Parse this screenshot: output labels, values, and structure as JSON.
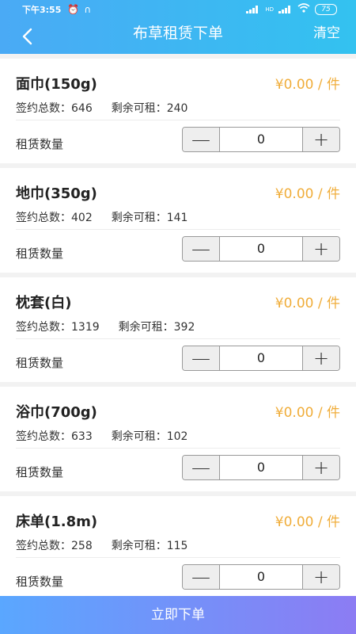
{
  "status_bar": {
    "time": "下午3:55",
    "battery": "75",
    "network": "HD"
  },
  "header": {
    "title": "布草租赁下单",
    "clear_label": "清空"
  },
  "labels": {
    "signed_total": "签约总数：",
    "remaining": "剩余可租：",
    "quantity": "租赁数量"
  },
  "items": [
    {
      "name": "面巾(150g)",
      "price": "¥0.00 / 件",
      "signed_total": "646",
      "remaining": "240",
      "quantity": "0"
    },
    {
      "name": "地巾(350g)",
      "price": "¥0.00 / 件",
      "signed_total": "402",
      "remaining": "141",
      "quantity": "0"
    },
    {
      "name": "枕套(白)",
      "price": "¥0.00 / 件",
      "signed_total": "1319",
      "remaining": "392",
      "quantity": "0"
    },
    {
      "name": "浴巾(700g)",
      "price": "¥0.00 / 件",
      "signed_total": "633",
      "remaining": "102",
      "quantity": "0"
    },
    {
      "name": "床单(1.8m)",
      "price": "¥0.00 / 件",
      "signed_total": "258",
      "remaining": "115",
      "quantity": "0"
    }
  ],
  "stepper": {
    "minus": "—",
    "plus": "+"
  },
  "submit_label": "立即下单",
  "colors": {
    "header_start": "#4aaaf5",
    "header_end": "#33c2f0",
    "price": "#f0ad3a",
    "submit_start": "#5aa7ff",
    "submit_end": "#8c7cf3"
  }
}
